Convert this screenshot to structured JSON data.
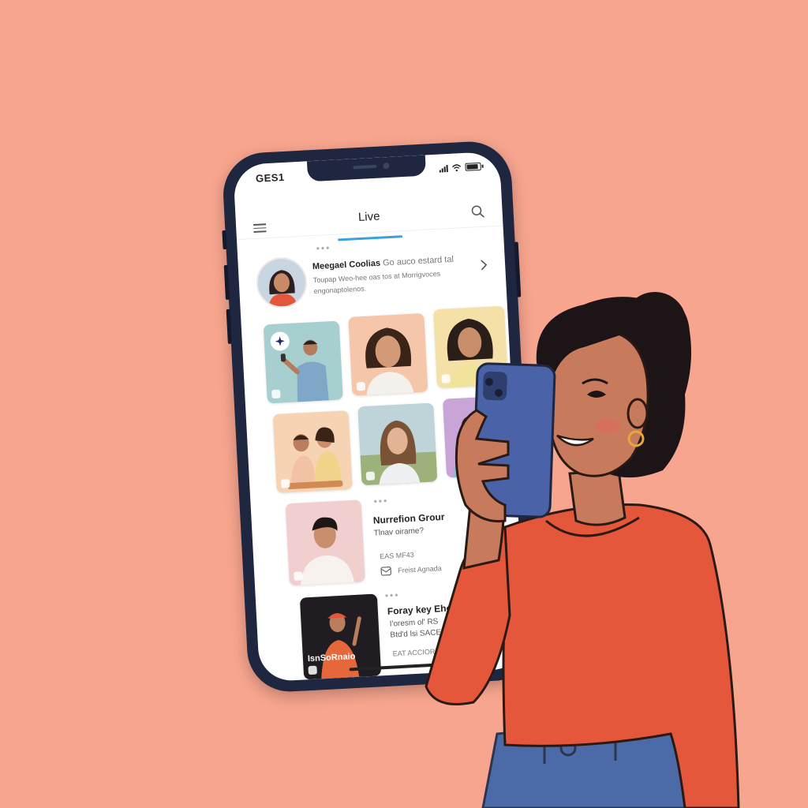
{
  "colors": {
    "background": "#F7A58E",
    "phone_frame": "#1F2740",
    "accent": "#3AA0E0",
    "sweater": "#E5573A",
    "held_phone": "#4A63A8",
    "jeans": "#4D6AA8"
  },
  "status_bar": {
    "time": "GES1"
  },
  "app_bar": {
    "tab_label": "Live",
    "menu_icon": "hamburger-menu-icon",
    "search_icon": "search-icon"
  },
  "featured": {
    "title": "Meegael Coolias",
    "subtitle": "Go auco estard tal",
    "description": "Toupap Weo-hee oas tos at Morrigvoces engonaptolenos."
  },
  "grid": [
    {
      "label": "creator-1",
      "bg": "#A8CFCF"
    },
    {
      "label": "creator-2",
      "bg": "#F6C6AA"
    },
    {
      "label": "creator-3",
      "bg": "#F5E1A8"
    },
    {
      "label": "creator-4",
      "bg": "#F6D3B3"
    },
    {
      "label": "creator-5",
      "bg": "#BFD4D8"
    },
    {
      "label": "creator-6",
      "bg": "#C9A4D6"
    }
  ],
  "list": [
    {
      "title": "Nurrefion Grour",
      "subtitle": "Tlnav oirame?",
      "meta": "EAS MF43",
      "action_label": "Freist Agnada"
    },
    {
      "title": "Foray key Eho",
      "line1": "I'oresm ol' RS",
      "line2": "Btd'd lsi SACE",
      "meta": "EAT ACCIORIC",
      "thumb_caption": "IsnSoRnaio"
    }
  ]
}
